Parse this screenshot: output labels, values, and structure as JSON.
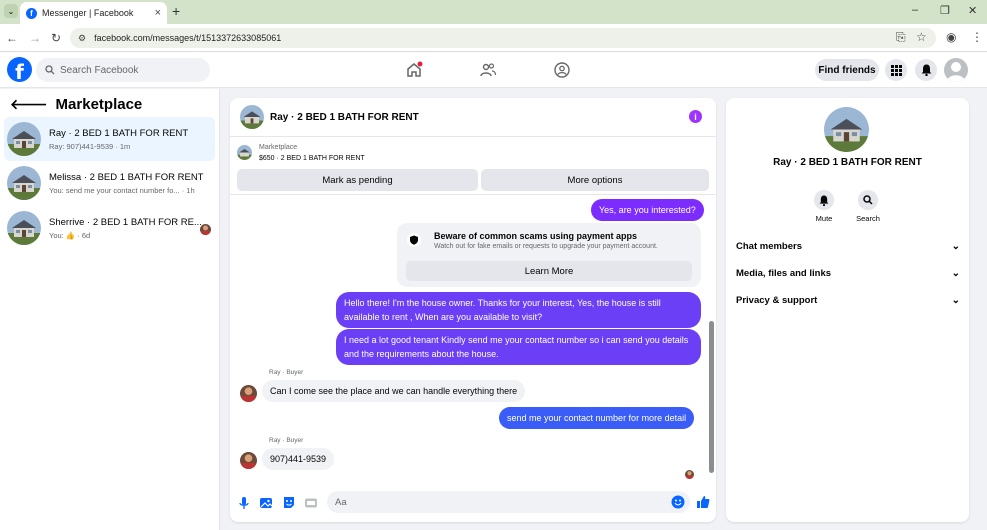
{
  "browser": {
    "tab_title": "Messenger | Facebook",
    "tab_favicon": "f",
    "new_tab": "+",
    "url": "facebook.com/messages/t/1513372633085061",
    "minimize": "–",
    "restore": "❐",
    "close": "✕"
  },
  "header": {
    "search_placeholder": "Search Facebook",
    "find_friends": "Find friends",
    "logo": "f"
  },
  "left_panel": {
    "title": "Marketplace",
    "conversations": [
      {
        "name": "Ray · 2 BED 1 BATH FOR RENT",
        "preview": "Ray: 907)441-9539 · 1m"
      },
      {
        "name": "Melissa · 2 BED 1 BATH FOR RENT",
        "preview": "You: send me your contact number fo... · 1h"
      },
      {
        "name": "Sherrive · 2 BED 1 BATH FOR RE...",
        "preview_prefix": "You:",
        "preview_suffix": "· 6d"
      }
    ]
  },
  "chat": {
    "title": "Ray · 2 BED 1 BATH FOR RENT",
    "info_icon": "i",
    "listing": {
      "label": "Marketplace",
      "detail": "$650 · 2 BED 1 BATH FOR RENT"
    },
    "mark_pending": "Mark as pending",
    "more_options": "More options",
    "scam_notice": {
      "title": "Beware of common scams using payment apps",
      "body": "Watch out for fake emails or requests to upgrade your payment account.",
      "button": "Learn More"
    },
    "messages": [
      {
        "side": "out",
        "text": "Yes, are you interested?"
      },
      {
        "side": "out",
        "text": "Hello there! I'm the house owner. Thanks for your interest, Yes, the house is still available to rent , When are you available to visit?"
      },
      {
        "side": "out",
        "text": "I need a lot good tenant Kindly send me your contact number so i can send you details and the requirements about the house."
      },
      {
        "side": "in",
        "sender": "Ray · Buyer",
        "text": "Can I come see the place and we can handle everything there"
      },
      {
        "side": "out",
        "text": "send me your contact number for more detail"
      },
      {
        "side": "in",
        "sender": "Ray · Buyer",
        "text": "907)441-9539"
      }
    ],
    "composer_placeholder": "Aa"
  },
  "right_panel": {
    "title": "Ray · 2 BED 1 BATH FOR RENT",
    "actions": [
      {
        "label": "Mute"
      },
      {
        "label": "Search"
      }
    ],
    "sections": [
      {
        "label": "Chat members"
      },
      {
        "label": "Media, files and links"
      },
      {
        "label": "Privacy & support"
      }
    ]
  },
  "colors": {
    "brand": "#0866ff",
    "outgoing_bubble": "#6b3ff5",
    "incoming_bubble": "#f0f2f5",
    "info": "#a033ff"
  }
}
